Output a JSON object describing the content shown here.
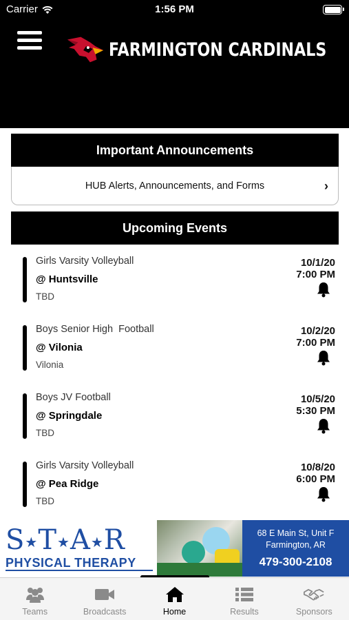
{
  "status_bar": {
    "carrier": "Carrier",
    "time": "1:56 PM"
  },
  "header": {
    "title": "FARMINGTON CARDINALS",
    "logo_icon": "cardinal-bird-icon",
    "menu_icon": "hamburger-icon"
  },
  "announcements": {
    "heading": "Important Announcements",
    "link_label": "HUB Alerts, Announcements, and Forms"
  },
  "events": {
    "heading": "Upcoming Events",
    "items": [
      {
        "sport": "Girls Varsity Volleyball",
        "opponent": "@ Huntsville",
        "location": "TBD",
        "date": "10/1/20",
        "time": "7:00 PM"
      },
      {
        "sport": "Boys Senior High  Football",
        "opponent": "@ Vilonia",
        "location": "Vilonia",
        "date": "10/2/20",
        "time": "7:00 PM"
      },
      {
        "sport": "Boys JV Football",
        "opponent": "@ Springdale",
        "location": "TBD",
        "date": "10/5/20",
        "time": "5:30 PM"
      },
      {
        "sport": "Girls Varsity Volleyball",
        "opponent": "@ Pea Ridge",
        "location": "TBD",
        "date": "10/8/20",
        "time": "6:00 PM"
      }
    ]
  },
  "sponsor_banner": {
    "brand_top": "S T A R",
    "brand_bottom": "PHYSICAL THERAPY",
    "address_line1": "68 E Main St, Unit F",
    "address_line2": "Farmington, AR",
    "phone": "479-300-2108",
    "brand_color": "#1f4ea3"
  },
  "tabs": [
    {
      "label": "Teams",
      "icon": "users-icon"
    },
    {
      "label": "Broadcasts",
      "icon": "video-camera-icon"
    },
    {
      "label": "Home",
      "icon": "home-icon"
    },
    {
      "label": "Results",
      "icon": "list-icon"
    },
    {
      "label": "Sponsors",
      "icon": "handshake-icon"
    }
  ]
}
